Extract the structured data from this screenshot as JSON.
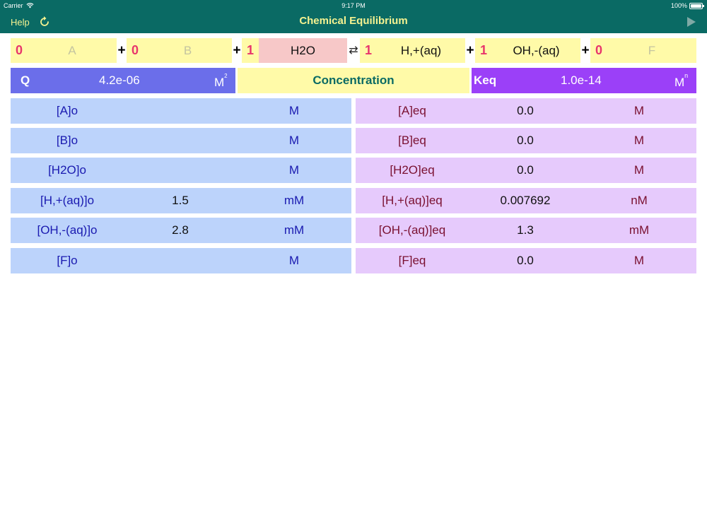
{
  "status_bar": {
    "carrier": "Carrier",
    "time": "9:17 PM",
    "battery": "100%"
  },
  "nav": {
    "help_label": "Help",
    "title": "Chemical Equilibrium",
    "refresh_icon": "refresh-icon",
    "play_icon": "play-icon"
  },
  "reaction": {
    "terms": [
      {
        "coef": "0",
        "species": "A"
      },
      {
        "coef": "0",
        "species": "B"
      },
      {
        "coef": "1",
        "species": "H2O"
      },
      {
        "coef": "1",
        "species": "H,+(aq)"
      },
      {
        "coef": "1",
        "species": "OH,-(aq)"
      },
      {
        "coef": "0",
        "species": "F"
      }
    ],
    "plus": "+",
    "arrow": "⇄"
  },
  "q": {
    "label": "Q",
    "value": "4.2e-06",
    "unit": "M",
    "unit_exp": "2"
  },
  "mode_button": "Concentration",
  "keq": {
    "label": "Keq",
    "value": "1.0e-14",
    "unit": "M",
    "unit_exp": "n"
  },
  "initial": [
    {
      "label": "[A]o",
      "value": "",
      "unit": "M"
    },
    {
      "label": "[B]o",
      "value": "",
      "unit": "M"
    },
    {
      "label": "[H2O]o",
      "value": "",
      "unit": "M"
    },
    {
      "label": "[H,+(aq)]o",
      "value": "1.5",
      "unit": "mM"
    },
    {
      "label": "[OH,-(aq)]o",
      "value": "2.8",
      "unit": "mM"
    },
    {
      "label": "[F]o",
      "value": "",
      "unit": "M"
    }
  ],
  "equilibrium": [
    {
      "label": "[A]eq",
      "value": "0.0",
      "unit": "M"
    },
    {
      "label": "[B]eq",
      "value": "0.0",
      "unit": "M"
    },
    {
      "label": "[H2O]eq",
      "value": "0.0",
      "unit": "M"
    },
    {
      "label": "[H,+(aq)]eq",
      "value": "0.007692",
      "unit": "nM"
    },
    {
      "label": "[OH,-(aq)]eq",
      "value": "1.3",
      "unit": "mM"
    },
    {
      "label": "[F]eq",
      "value": "0.0",
      "unit": "M"
    }
  ],
  "colors": {
    "header": "#0a6a64",
    "header_text": "#f5f290",
    "coef": "#e8356c",
    "species_bg": "#fffaa8",
    "h2o_bg": "#f7c8c8",
    "q_bg": "#6b6eea",
    "keq_bg": "#9b40f8",
    "initial_bg": "#bcd3fb",
    "initial_text": "#1a1ab0",
    "eq_bg": "#e6cafc",
    "eq_text": "#7a1030"
  }
}
